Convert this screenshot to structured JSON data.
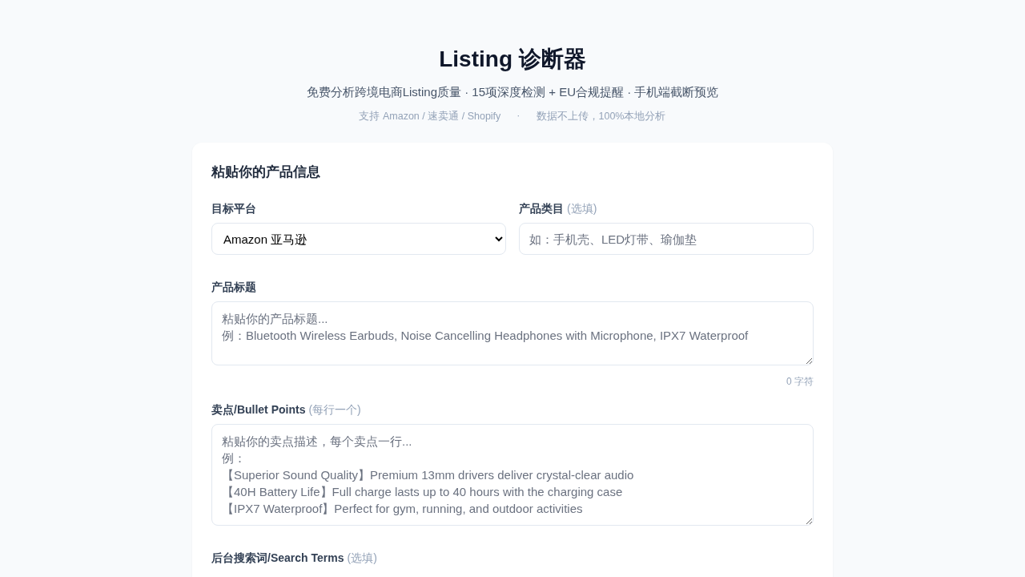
{
  "header": {
    "title": "Listing 诊断器",
    "subtitle": "免费分析跨境电商Listing质量 · 15项深度检测 + EU合规提醒 · 手机端截断预览",
    "meta": [
      "支持 Amazon / 速卖通 / Shopify",
      "·",
      "数据不上传，100%本地分析"
    ]
  },
  "form": {
    "title": "粘贴你的产品信息",
    "rows": [
      [
        {
          "kind": "select",
          "label": "目标平台",
          "value": "Amazon 亚马逊"
        },
        {
          "kind": "input",
          "label": "产品类目",
          "hint": "(选填)",
          "placeholder": "如：手机壳、LED灯带、瑜伽垫"
        }
      ],
      [
        {
          "kind": "textarea",
          "label": "产品标题",
          "placeholder": [
            "粘贴你的产品标题...",
            "例：Bluetooth Wireless Earbuds, Noise Cancelling Headphones with Microphone, IPX7 Waterproof"
          ],
          "counter": "0 字符"
        }
      ],
      [
        {
          "kind": "textarea",
          "label": "卖点/Bullet Points",
          "hint": "(每行一个)",
          "placeholder": [
            "粘贴你的卖点描述，每个卖点一行...",
            "例：",
            "【Superior Sound Quality】Premium 13mm drivers deliver crystal-clear audio",
            "【40H Battery Life】Full charge lasts up to 40 hours with the charging case",
            "【IPX7 Waterproof】Perfect for gym, running, and outdoor activities"
          ]
        }
      ],
      [
        {
          "kind": "textarea",
          "label": "后台搜索词/Search Terms",
          "hint": "(选填)"
        }
      ]
    ]
  }
}
